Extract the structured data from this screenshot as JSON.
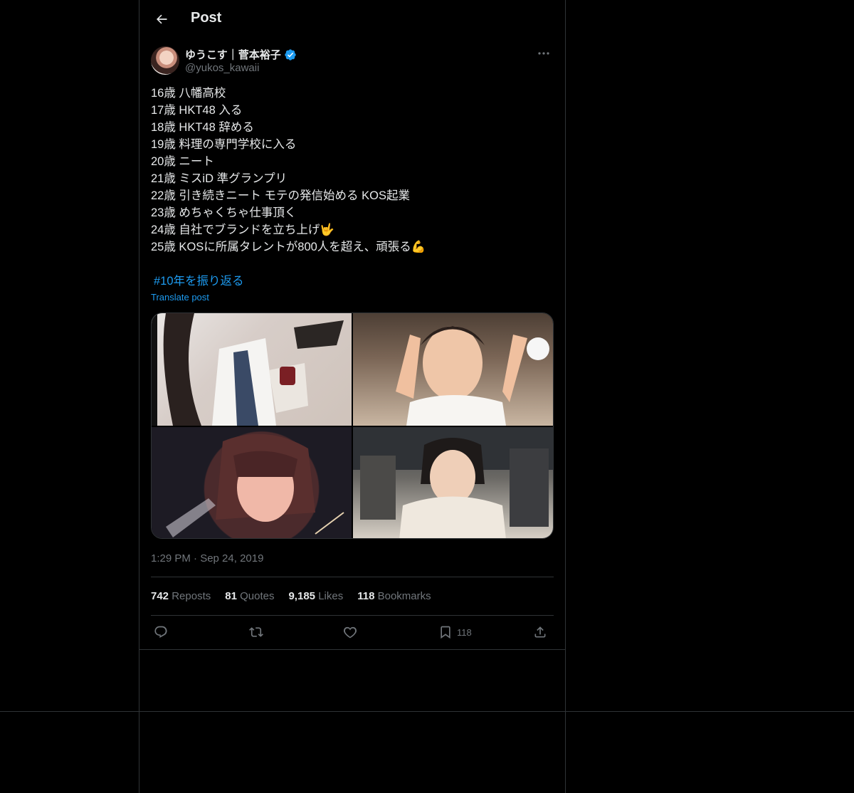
{
  "header": {
    "title": "Post"
  },
  "author": {
    "display_name": "ゆうこす｜菅本裕子",
    "handle": "@yukos_kawaii",
    "verified": true
  },
  "post": {
    "lines": [
      "16歳 八幡高校",
      "17歳 HKT48 入る",
      "18歳 HKT48 辞める",
      "19歳 料理の専門学校に入る",
      "20歳 ニート",
      "21歳 ミスiD 準グランプリ",
      "22歳 引き続きニート モテの発信始める KOS起業",
      "23歳 めちゃくちゃ仕事頂く",
      "24歳 自社でブランドを立ち上げ🤟",
      "25歳 KOSに所属タレントが800人を超え、頑張る💪"
    ],
    "hashtag": "#10年を振り返る",
    "translate": "Translate post",
    "timestamp": "1:29 PM · Sep 24, 2019"
  },
  "stats": {
    "reposts": "742",
    "reposts_label": "Reposts",
    "quotes": "81",
    "quotes_label": "Quotes",
    "likes": "9,185",
    "likes_label": "Likes",
    "bookmarks": "118",
    "bookmarks_label": "Bookmarks"
  },
  "actions": {
    "bookmark_count": "118"
  },
  "colors": {
    "accent": "#1d9bf0",
    "muted": "#71767b",
    "text": "#e7e9ea",
    "border": "#2f3336",
    "background": "#000000"
  },
  "icons": [
    "back-arrow-icon",
    "verified-badge-icon",
    "more-icon",
    "reply-icon",
    "repost-icon",
    "like-icon",
    "bookmark-icon",
    "share-icon"
  ]
}
